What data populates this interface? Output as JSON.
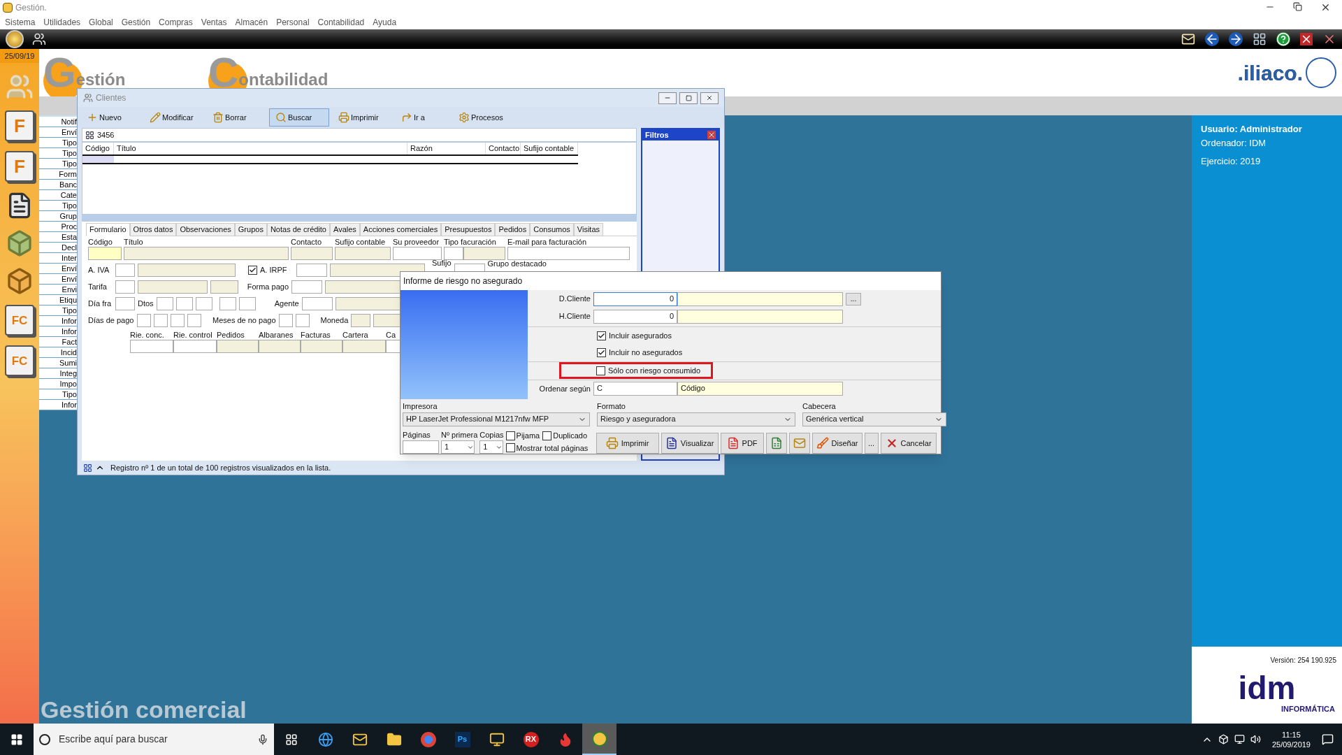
{
  "app": {
    "title": "Gestión.",
    "menu": [
      "Sistema",
      "Utilidades",
      "Global",
      "Gestión",
      "Compras",
      "Ventas",
      "Almacén",
      "Personal",
      "Contabilidad",
      "Ayuda"
    ]
  },
  "sidebar": {
    "date": "25/09/19",
    "icons": [
      {
        "kind": "people"
      },
      {
        "kind": "doc",
        "letters": "F"
      },
      {
        "kind": "doc",
        "letters": "F"
      },
      {
        "kind": "list"
      },
      {
        "kind": "bag"
      },
      {
        "kind": "bag"
      },
      {
        "kind": "doc",
        "letters": "FC"
      },
      {
        "kind": "doc",
        "letters": "FC"
      }
    ]
  },
  "header": {
    "logos": [
      {
        "big": "G",
        "rest": "estión"
      },
      {
        "big": "C",
        "rest": "ontabilidad"
      }
    ],
    "brand": ".iliaco."
  },
  "left_list": [
    "Notif",
    "Enví",
    "Tipo",
    "Tipo",
    "Tipo",
    "Form",
    "Banc",
    "Cate",
    "Tipo",
    "Grup",
    "Proc",
    "Esta",
    "Decl",
    "Inter",
    "Enví",
    "Enví",
    "Envi",
    "Etiqu",
    "Tipo",
    "Infor",
    "Infor",
    "Fact",
    "Incid",
    "Sumi",
    "Integ",
    "Impo",
    "Tipo",
    "Infor"
  ],
  "user_panel": {
    "user": "Usuario: Administrador",
    "computer": "Ordenador: IDM",
    "year": "Ejercicio: 2019",
    "version": "Versión: 254 190.925",
    "logo": "idm",
    "logo_sub": "INFORMÁTICA"
  },
  "footer_title": "Gestión comercial",
  "clientes": {
    "title": "Clientes",
    "toolbar": [
      {
        "label": "Nuevo",
        "selected": false
      },
      {
        "label": "Modificar",
        "selected": false
      },
      {
        "label": "Borrar",
        "selected": false
      },
      {
        "label": "Buscar",
        "selected": true
      },
      {
        "label": "Imprimir",
        "selected": false
      },
      {
        "label": "Ir a",
        "selected": false
      },
      {
        "label": "Procesos",
        "selected": false
      }
    ],
    "search": "3456",
    "columns": [
      "Código",
      "Título",
      "Razón",
      "Contacto",
      "Sufijo contable"
    ],
    "filters_title": "Filtros",
    "tabs": [
      {
        "label": "Formulario",
        "selected": true
      },
      {
        "label": "Otros datos",
        "selected": false
      },
      {
        "label": "Observaciones",
        "selected": false
      },
      {
        "label": "Grupos",
        "selected": false
      },
      {
        "label": "Notas de crédito",
        "selected": false
      },
      {
        "label": "Avales",
        "selected": false
      },
      {
        "label": "Acciones comerciales",
        "selected": false
      },
      {
        "label": "Presupuestos",
        "selected": false
      },
      {
        "label": "Pedidos",
        "selected": false
      },
      {
        "label": "Consumos",
        "selected": false
      },
      {
        "label": "Visitas",
        "selected": false
      }
    ],
    "form": {
      "top_labels": [
        "Código",
        "Título",
        "Contacto",
        "Sufijo contable",
        "Su proveedor",
        "Tipo facuración",
        "E-mail para facturación"
      ],
      "iva": "A. IVA",
      "irpf": {
        "label": "A. IRPF",
        "checked": true
      },
      "sufijo": "Sufijo",
      "grupo": "Grupo destacado",
      "tarifa": "Tarifa",
      "forma_pago": "Forma pago",
      "dia_fra": "Día fra",
      "dtos": "Dtos",
      "agente": "Agente",
      "dias_pago": "Días de pago",
      "meses": "Meses de no pago",
      "moneda": "Moneda",
      "bottom_labels": [
        "Rie. conc.",
        "Rie. control",
        "Pedidos",
        "Albaranes",
        "Facturas",
        "Cartera",
        "Ca"
      ]
    },
    "status": "Registro nº 1 de un total de 100 registros visualizados en la lista."
  },
  "dialog": {
    "title": "Informe de riesgo no asegurado",
    "from": {
      "label": "D.Cliente",
      "value": "0",
      "browse": "..."
    },
    "to": {
      "label": "H.Cliente",
      "value": "0"
    },
    "checks": [
      {
        "label": "Incluir asegurados",
        "checked": true,
        "highlighted": false
      },
      {
        "label": "Incluir no asegurados",
        "checked": true,
        "highlighted": false
      },
      {
        "label": "Sólo con riesgo consumido",
        "checked": false,
        "highlighted": true
      }
    ],
    "order": {
      "label": "Ordenar según",
      "value": "C",
      "name": "Código"
    },
    "selects": [
      {
        "label": "Impresora",
        "value": "HP LaserJet Professional M1217nfw MFP"
      },
      {
        "label": "Formato",
        "value": "Riesgo y aseguradora"
      },
      {
        "label": "Cabecera",
        "value": "Genérica vertical"
      }
    ],
    "pages": {
      "label": "Páginas",
      "first_label": "Nº primera",
      "first": "1",
      "copies_label": "Copias",
      "copies": "1"
    },
    "options": [
      {
        "label": "Pijama",
        "checked": false
      },
      {
        "label": "Duplicado",
        "checked": false
      },
      {
        "label": "Mostrar total páginas",
        "checked": false
      }
    ],
    "buttons": [
      {
        "kind": "print",
        "label": "Imprimir"
      },
      {
        "kind": "preview",
        "label": "Visualizar"
      },
      {
        "kind": "pdf",
        "label": "PDF"
      },
      {
        "kind": "excel"
      },
      {
        "kind": "mail"
      },
      {
        "kind": "design",
        "label": "Diseñar"
      },
      {
        "kind": "more",
        "label": "..."
      },
      {
        "kind": "cancel",
        "label": "Cancelar"
      }
    ]
  },
  "taskbar": {
    "search_placeholder": "Escribe aquí para buscar",
    "apps": [
      {
        "kind": "taskview"
      },
      {
        "kind": "edge"
      },
      {
        "kind": "mail"
      },
      {
        "kind": "folder"
      },
      {
        "kind": "chrome"
      },
      {
        "kind": "tile",
        "text": "Ps"
      },
      {
        "kind": "app"
      },
      {
        "kind": "tile",
        "text": "RX"
      },
      {
        "kind": "flame"
      },
      {
        "kind": "gestion",
        "selected": true
      }
    ],
    "time": "11:15",
    "date": "25/09/2019"
  }
}
